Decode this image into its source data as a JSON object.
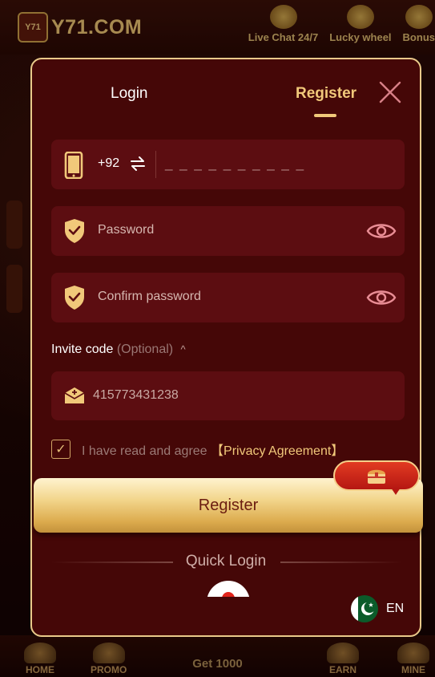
{
  "app": {
    "logo_badge": "Y71",
    "logo_text": "Y71.COM",
    "top_actions": [
      {
        "label": "Live Chat 24/7",
        "icon": "headset-icon"
      },
      {
        "label": "Lucky wheel",
        "icon": "wheel-icon"
      },
      {
        "label": "Bonus",
        "icon": "gift-icon"
      }
    ],
    "bottom_nav": {
      "home": "HOME",
      "promo": "PROMO",
      "center": "Get 1000",
      "earn": "EARN",
      "mine": "MINE"
    }
  },
  "modal": {
    "tabs": {
      "login": "Login",
      "register": "Register",
      "active": "register"
    },
    "phone": {
      "country_code": "+92",
      "placeholder": "_ _ _ _ _ _ _ _ _ _"
    },
    "password": {
      "placeholder": "Password"
    },
    "confirm_password": {
      "placeholder": "Confirm password"
    },
    "invite": {
      "label": "Invite code",
      "optional": "(Optional)",
      "value": "415773431238"
    },
    "agreement": {
      "checked": true,
      "text": "I have read and agree",
      "link": "【Privacy Agreement】"
    },
    "register_button": "Register",
    "quick_login": "Quick Login",
    "language": {
      "code": "EN",
      "flag": "pakistan-flag"
    }
  },
  "colors": {
    "modal_bg": "#450707",
    "field_bg": "#5c0d11",
    "gold_accent": "#f1c87a",
    "border": "#e9c98a"
  }
}
